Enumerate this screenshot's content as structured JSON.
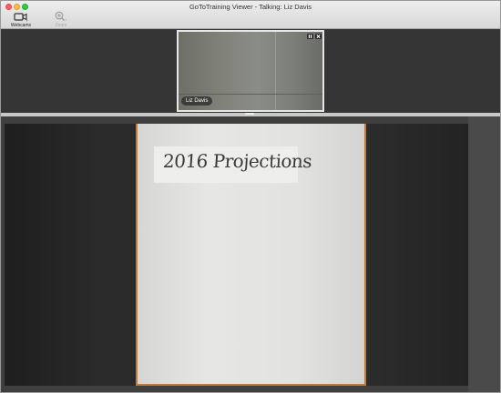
{
  "window": {
    "title": "GoToTraining Viewer - Talking: Liz Davis"
  },
  "toolbar": {
    "webcams_label": "Webcams",
    "zoom_label": "Zoom"
  },
  "webcam": {
    "presenter_name": "Liz Davis"
  },
  "shared_video": {
    "whiteboard_text": "2016 Projections"
  },
  "colors": {
    "board_frame": "#c47a3a",
    "background": "#3a3a3a"
  }
}
